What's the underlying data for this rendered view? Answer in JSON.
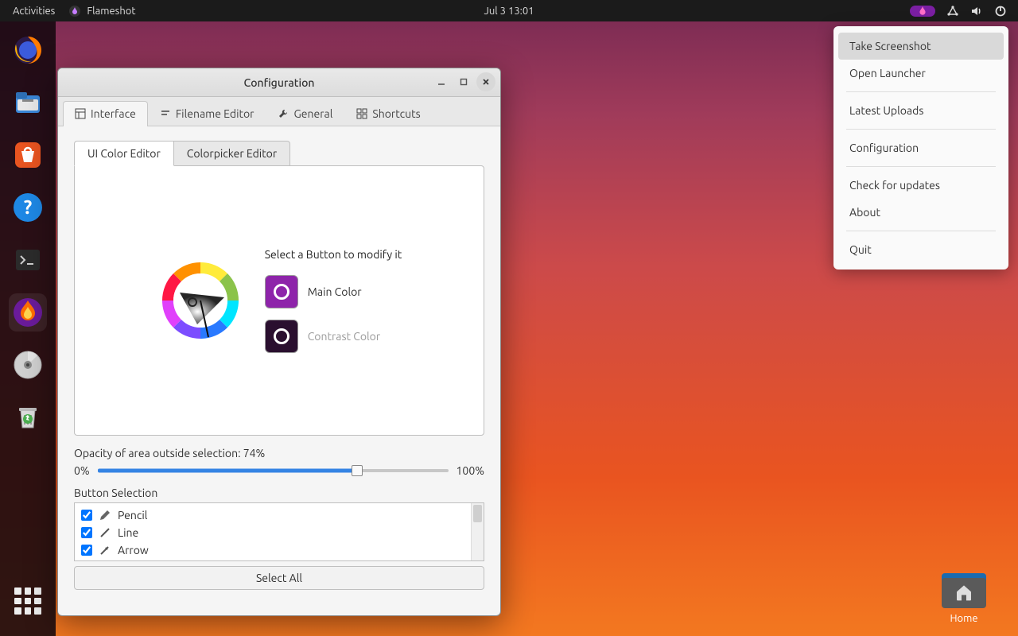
{
  "topbar": {
    "activities": "Activities",
    "app_name": "Flameshot",
    "datetime": "Jul 3  13:01"
  },
  "dock": {
    "items": [
      "firefox",
      "files",
      "software",
      "help",
      "terminal",
      "flameshot",
      "disc",
      "trash"
    ]
  },
  "desktop": {
    "home_label": "Home"
  },
  "tray_menu": {
    "items": [
      {
        "label": "Take Screenshot",
        "hover": true
      },
      {
        "label": "Open Launcher"
      },
      {
        "sep": true
      },
      {
        "label": "Latest Uploads"
      },
      {
        "sep": true
      },
      {
        "label": "Configuration"
      },
      {
        "sep": true
      },
      {
        "label": "Check for updates"
      },
      {
        "label": "About"
      },
      {
        "sep": true
      },
      {
        "label": "Quit"
      }
    ]
  },
  "window": {
    "title": "Configuration",
    "tabs": [
      {
        "label": "Interface",
        "active": true,
        "icon": "layout"
      },
      {
        "label": "Filename Editor",
        "icon": "filename"
      },
      {
        "label": "General",
        "icon": "wrench"
      },
      {
        "label": "Shortcuts",
        "icon": "grid"
      }
    ],
    "subtabs": [
      {
        "label": "UI Color Editor",
        "active": true
      },
      {
        "label": "Colorpicker Editor"
      }
    ],
    "color_editor": {
      "prompt": "Select a Button to modify it",
      "main_label": "Main Color",
      "contrast_label": "Contrast Color",
      "main_color": "#8e24aa",
      "contrast_color": "#2a0f2f"
    },
    "opacity": {
      "label": "Opacity of area outside selection: 74%",
      "min_label": "0%",
      "max_label": "100%",
      "value": 74
    },
    "button_selection": {
      "label": "Button Selection",
      "items": [
        {
          "label": "Pencil",
          "checked": true,
          "icon": "pencil"
        },
        {
          "label": "Line",
          "checked": true,
          "icon": "line"
        },
        {
          "label": "Arrow",
          "checked": true,
          "icon": "arrow"
        }
      ],
      "select_all": "Select All"
    }
  }
}
